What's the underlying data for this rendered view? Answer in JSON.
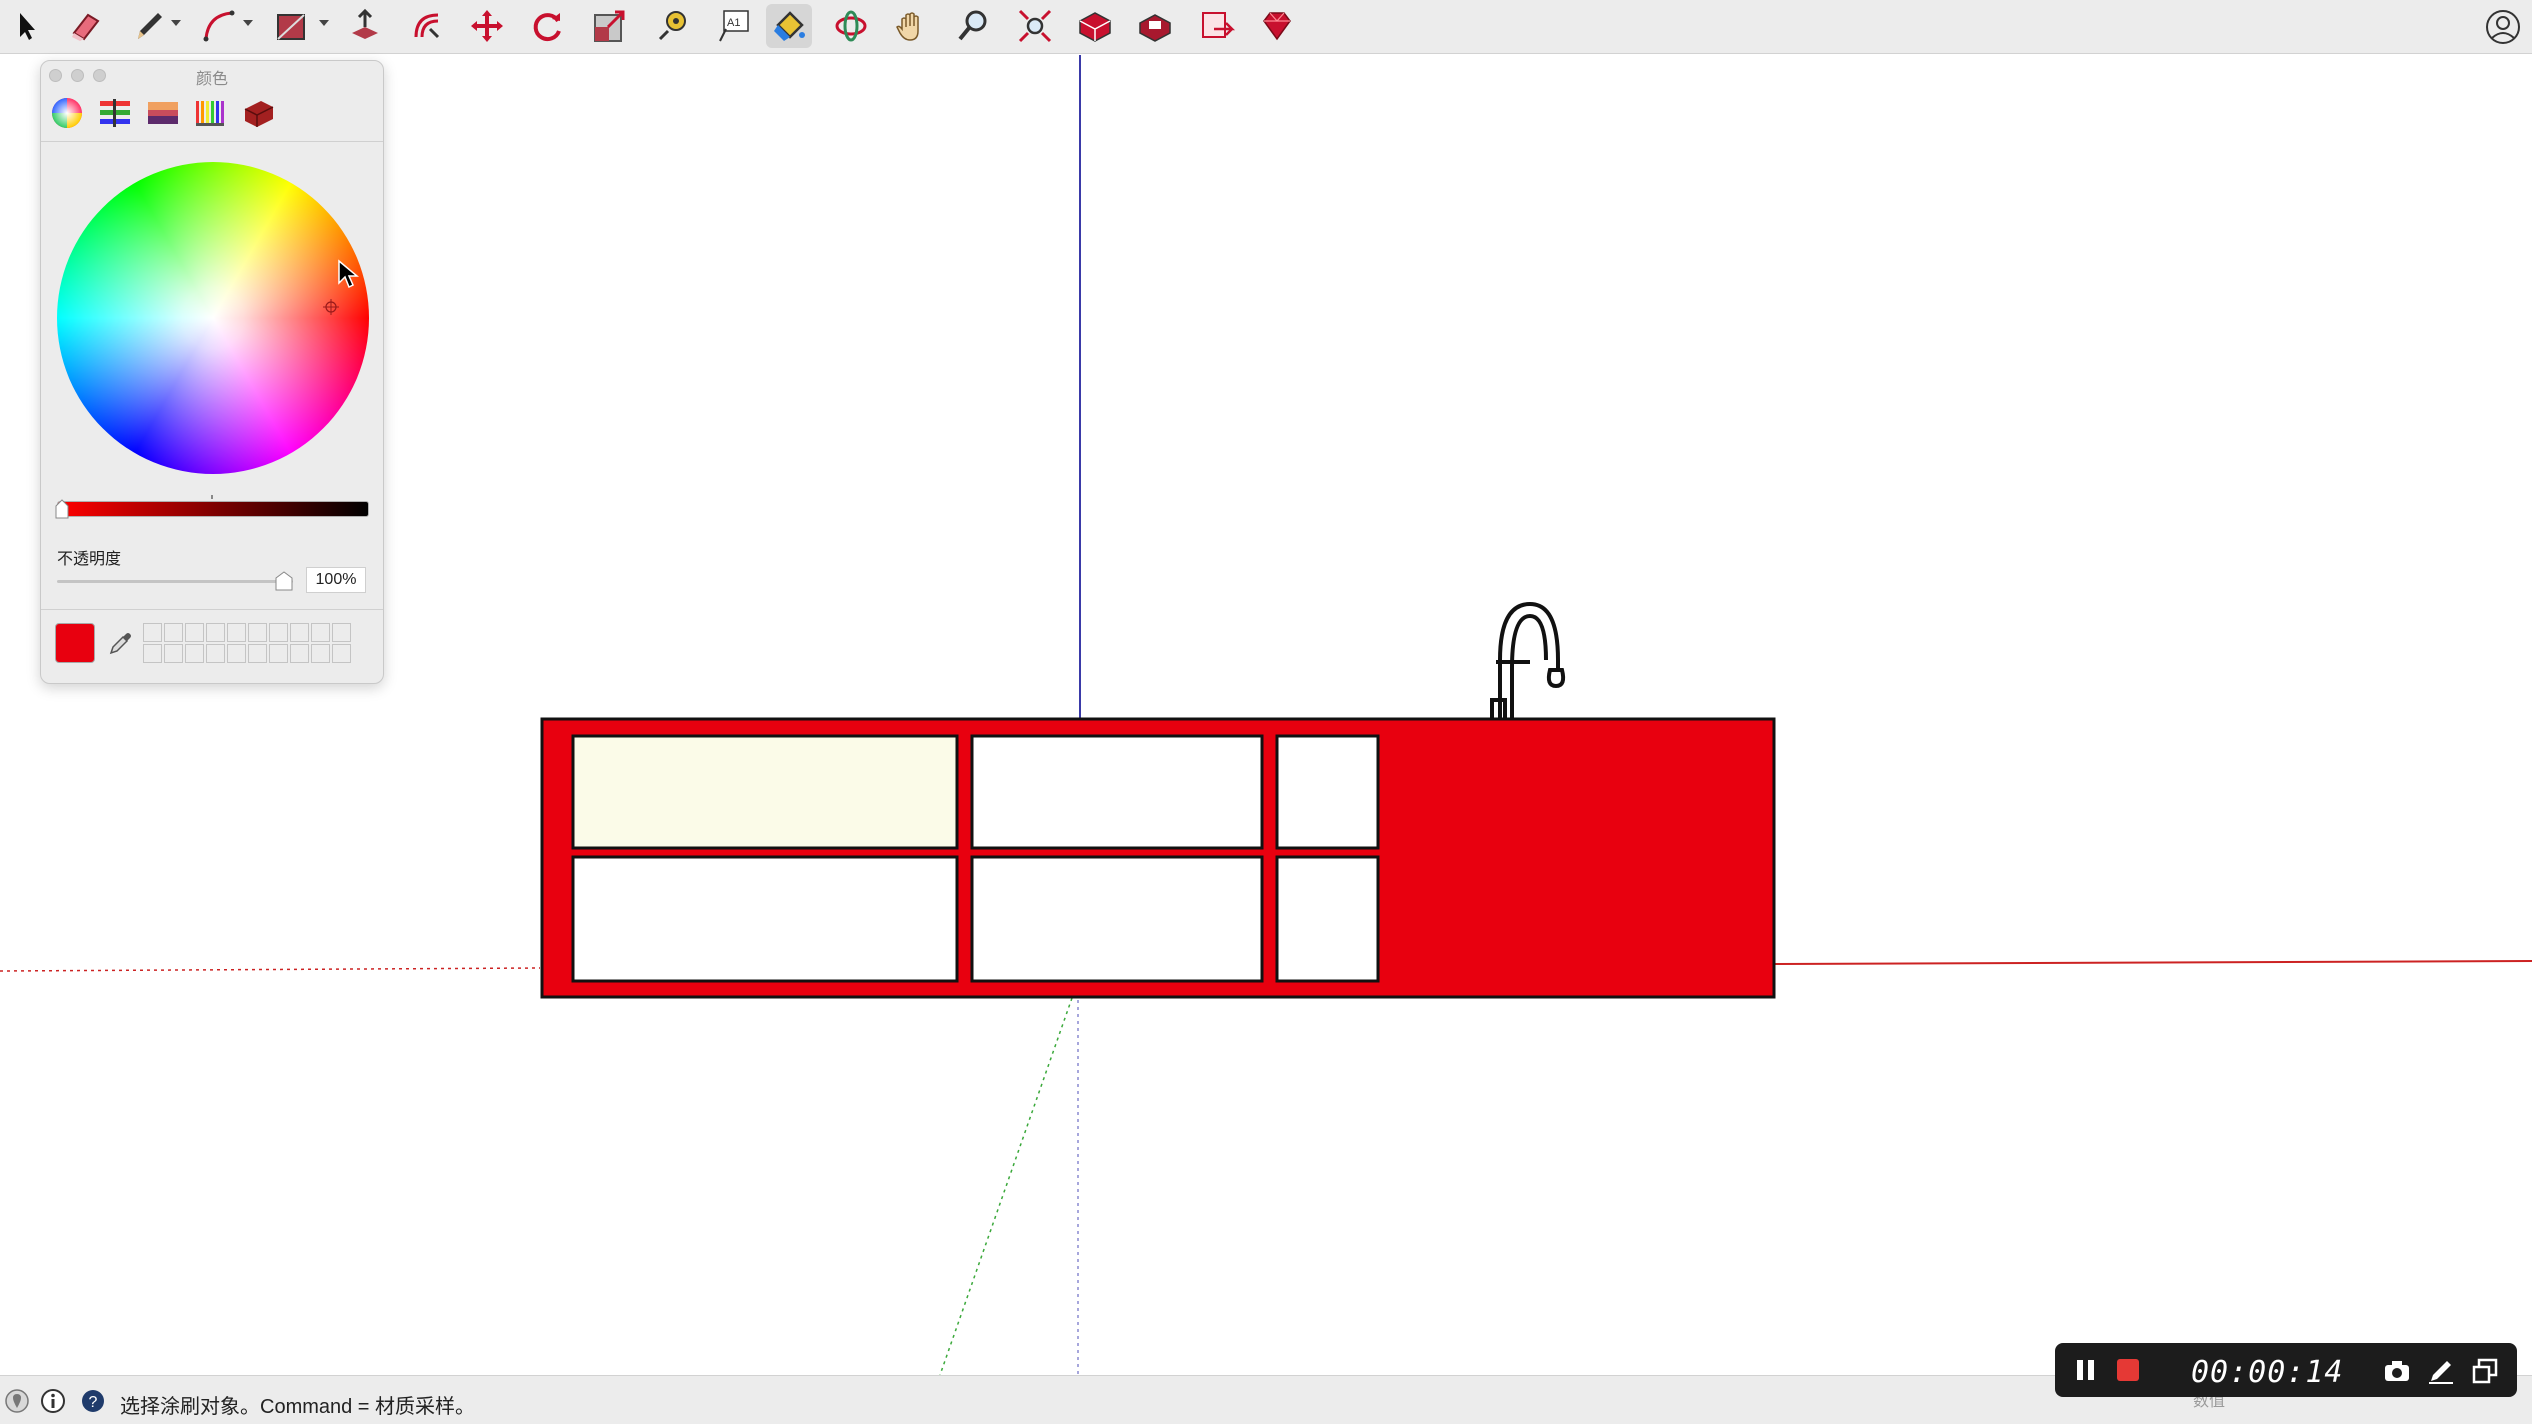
{
  "toolbar": {
    "tools": [
      {
        "name": "select-tool",
        "icon": "arrow-icon"
      },
      {
        "name": "eraser-tool",
        "icon": "eraser-icon"
      },
      {
        "name": "line-tool",
        "icon": "pencil-icon",
        "dropdown": true
      },
      {
        "name": "arc-tool",
        "icon": "arc-icon",
        "dropdown": true
      },
      {
        "name": "shape-tool",
        "icon": "rectangle-icon",
        "dropdown": true
      },
      {
        "name": "push-pull-tool",
        "icon": "push-pull-icon"
      },
      {
        "name": "offset-tool",
        "icon": "offset-icon"
      },
      {
        "name": "move-tool",
        "icon": "move-icon"
      },
      {
        "name": "rotate-tool",
        "icon": "rotate-icon"
      },
      {
        "name": "scale-tool",
        "icon": "scale-icon"
      },
      {
        "name": "tape-measure-tool",
        "icon": "tape-measure-icon"
      },
      {
        "name": "text-tool",
        "icon": "text-icon",
        "label": "A1"
      },
      {
        "name": "paint-bucket-tool",
        "icon": "paint-bucket-icon",
        "active": true
      },
      {
        "name": "orbit-tool",
        "icon": "orbit-icon"
      },
      {
        "name": "pan-tool",
        "icon": "hand-icon"
      },
      {
        "name": "zoom-tool",
        "icon": "magnifier-icon"
      },
      {
        "name": "zoom-extents-tool",
        "icon": "zoom-extents-icon"
      },
      {
        "name": "3d-warehouse-tool",
        "icon": "warehouse-icon"
      },
      {
        "name": "extension-warehouse-tool",
        "icon": "extension-warehouse-icon"
      },
      {
        "name": "layout-tool",
        "icon": "layout-icon"
      },
      {
        "name": "ruby-console-tool",
        "icon": "ruby-icon"
      }
    ],
    "user_icon": "user-circle-icon"
  },
  "color_panel": {
    "title": "颜色",
    "tabs": [
      "color-wheel-icon",
      "color-sliders-icon",
      "color-palettes-icon",
      "image-palettes-icon",
      "pencils-icon"
    ],
    "opacity_label": "不透明度",
    "opacity_value": "100%",
    "opacity_level": 1.0,
    "brightness_level": 0.0,
    "current_color": "#e8000f",
    "swatch_rows": 2,
    "swatch_cols": 10
  },
  "model": {
    "cabinet_color": "#e8000f",
    "highlight_panel_color": "#fbfbe8",
    "axis_blue": "#3a3aa8",
    "axis_red": "#cc2222",
    "axis_green": "#3aa83a"
  },
  "statusbar": {
    "icons": [
      "geolocation-icon",
      "info-icon",
      "help-icon"
    ],
    "message": "选择涂刷对象。Command = 材质采样。",
    "measure_label": "数值"
  },
  "recorder": {
    "time": "00:00:14",
    "buttons": [
      "pause-icon",
      "stop-icon",
      "camera-icon",
      "pen-icon",
      "window-icon"
    ]
  }
}
